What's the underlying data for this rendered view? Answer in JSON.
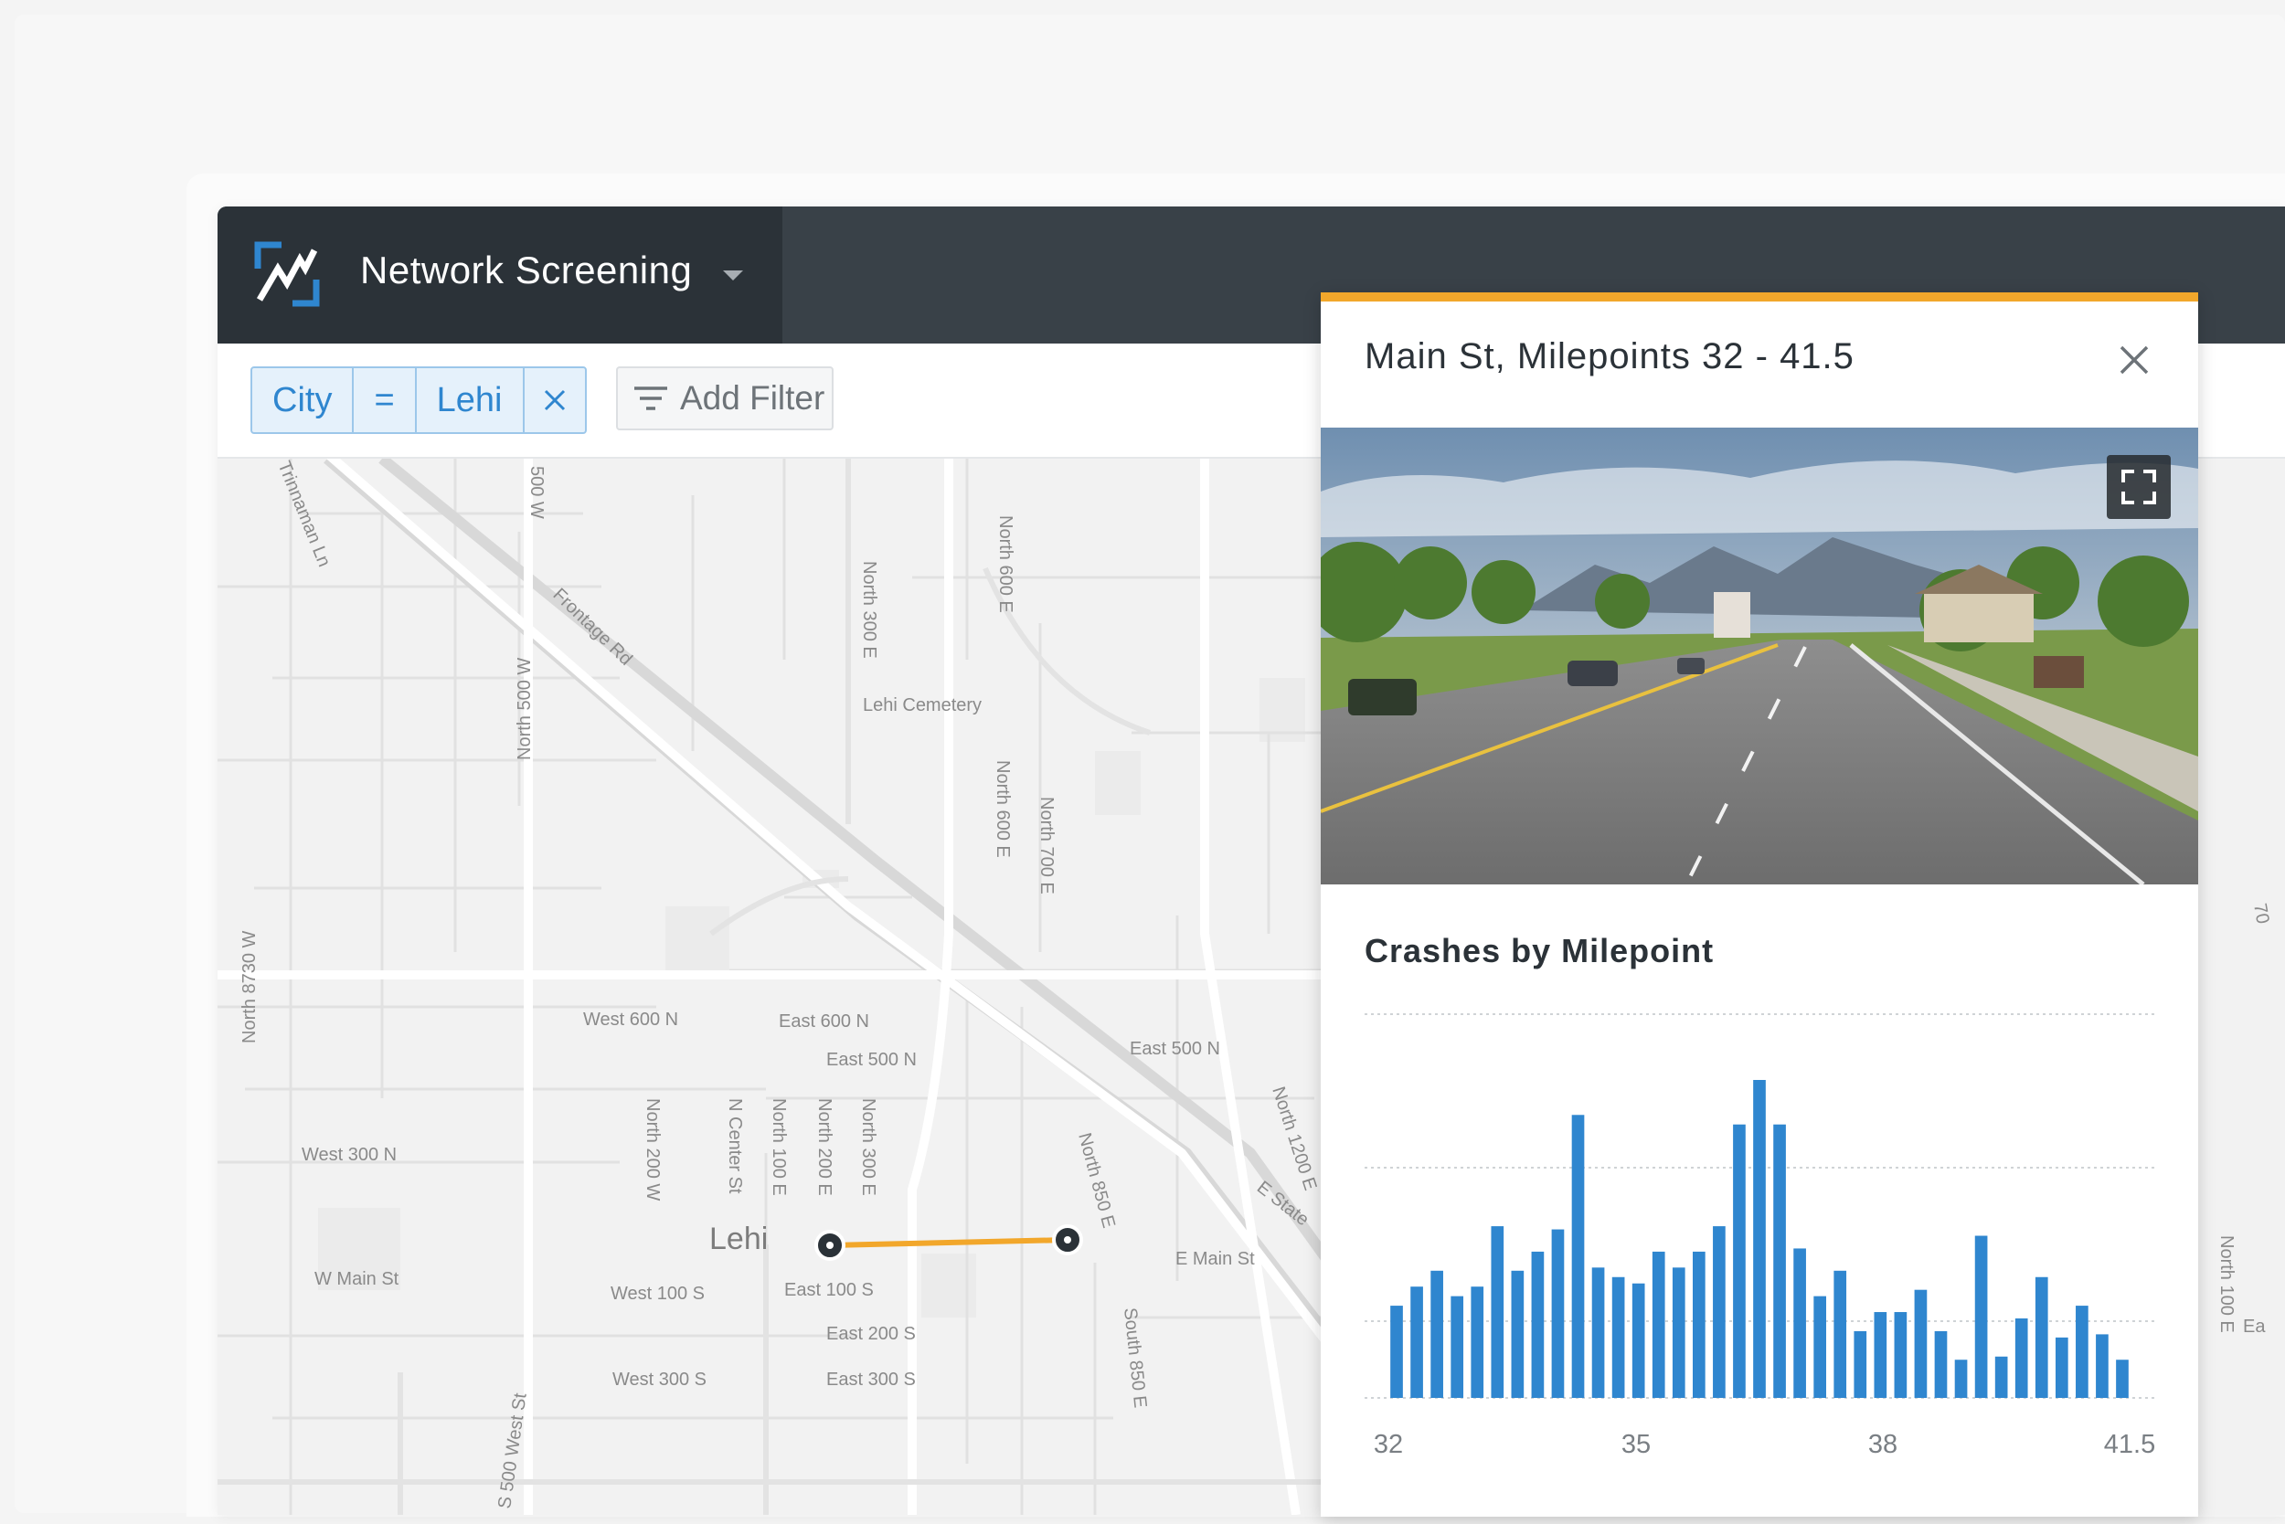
{
  "app": {
    "title": "Network Screening",
    "logo_icon": "trend-chart-logo-icon",
    "accent_color": "#2f86cf"
  },
  "filters": {
    "chip": {
      "field": "City",
      "operator": "=",
      "value": "Lehi",
      "remove_icon": "close-icon"
    },
    "add_filter_label": "Add Filter",
    "add_filter_icon": "filter-icon"
  },
  "map": {
    "place_label": "Lehi",
    "segment_color": "#f2a72b",
    "street_labels": [
      "Trinnaman Ln",
      "500 W",
      "Frontage Rd",
      "North 300 E",
      "North 600 E",
      "Lehi Cemetery",
      "North 500 W",
      "North 600 E",
      "North 700 E",
      "North 8730 W",
      "West 600 N",
      "East 600 N",
      "East 500 N",
      "East 500 N",
      "West 300 N",
      "North 200 W",
      "N Center St",
      "North 100 E",
      "North 200 E",
      "North 300 E",
      "North 850 E",
      "North 1200 E",
      "E State",
      "W Main St",
      "E Main St",
      "West 100 S",
      "East 100 S",
      "East 200 S",
      "West 300 S",
      "East 300 S",
      "South 850 E",
      "S 500 West St",
      "North 100 E",
      "Ea",
      "70"
    ]
  },
  "panel": {
    "title": "Main St, Milepoints 32 - 41.5",
    "close_icon": "close-icon",
    "expand_icon": "fullscreen-icon",
    "accent_color": "#f2a72b",
    "chart_title": "Crashes by Milepoint"
  },
  "chart_data": {
    "type": "bar",
    "title": "Crashes by Milepoint",
    "xlabel": "",
    "ylabel": "",
    "x_ticks": [
      "32",
      "35",
      "38",
      "41.5"
    ],
    "xlim": [
      32,
      41.5
    ],
    "ylim": [
      0,
      10
    ],
    "grid": true,
    "color": "#2f86cf",
    "values": [
      2.9,
      3.5,
      4.0,
      3.2,
      3.5,
      5.4,
      4.0,
      4.6,
      5.3,
      8.9,
      4.1,
      3.8,
      3.6,
      4.6,
      4.1,
      4.6,
      5.4,
      8.6,
      10.0,
      8.6,
      4.7,
      3.2,
      4.0,
      2.1,
      2.7,
      2.7,
      3.4,
      2.1,
      1.2,
      5.1,
      1.3,
      2.5,
      3.8,
      1.9,
      2.9,
      2.0,
      1.2
    ]
  }
}
